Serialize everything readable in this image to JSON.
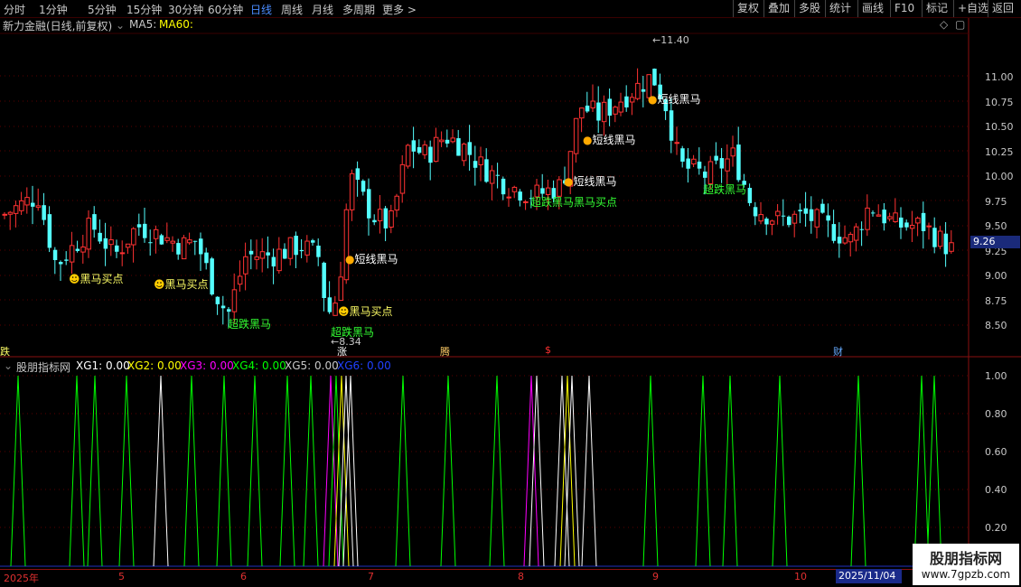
{
  "toolbar": {
    "periods": [
      "分时",
      "1分钟",
      "5分钟",
      "15分钟",
      "30分钟",
      "60分钟",
      "日线",
      "周线",
      "月线",
      "多周期",
      "更多 >"
    ],
    "active": "日线",
    "right_buttons": [
      "复权",
      "叠加",
      "多股",
      "统计",
      "画线",
      "F10",
      "标记",
      "+自选",
      "返回"
    ]
  },
  "chart": {
    "title": "新力金融(日线,前复权)",
    "ma5": "MA5:",
    "ma60": "MA60:",
    "y_ticks": [
      "11.00",
      "10.75",
      "10.50",
      "10.25",
      "10.00",
      "9.75",
      "9.50",
      "9.25",
      "9.00",
      "8.75",
      "8.50"
    ],
    "current_price": "9.26",
    "high_label": "11.40",
    "low_label": "8.34",
    "signals": [
      "黑马买点",
      "黑马买点",
      "超跌黑马",
      "短线黑马",
      "黑马买点",
      "超跌黑马",
      "短线黑马",
      "短线黑马",
      "超跌黑马黑马买点",
      "短线黑马",
      "超跌黑马"
    ],
    "bottom_marks": [
      "跌",
      "涨",
      "腾",
      "$",
      "财"
    ]
  },
  "indicator": {
    "name": "股朋指标网",
    "xg1": "XG1: 0.00",
    "xg2": "XG2: 0.00",
    "xg3": "XG3: 0.00",
    "xg4": "XG4: 0.00",
    "xg5": "XG5: 0.00",
    "xg6": "XG6: 0.00",
    "y_ticks": [
      "1.00",
      "0.80",
      "0.60",
      "0.40",
      "0.20"
    ]
  },
  "dates": [
    "2025年",
    "5",
    "6",
    "7",
    "8",
    "9",
    "10"
  ],
  "date_highlight": "2025/11/04",
  "watermark": {
    "line1": "股朋指标网",
    "line2": "www.7gpzb.com"
  },
  "colors": {
    "up": "#ff3232",
    "down": "#54ffff",
    "xg1": "#ffffff",
    "xg2": "#ffff00",
    "xg3": "#ff00ff",
    "xg4": "#00ff00",
    "xg5": "#c8c8c8",
    "xg6": "#0000ff"
  }
}
